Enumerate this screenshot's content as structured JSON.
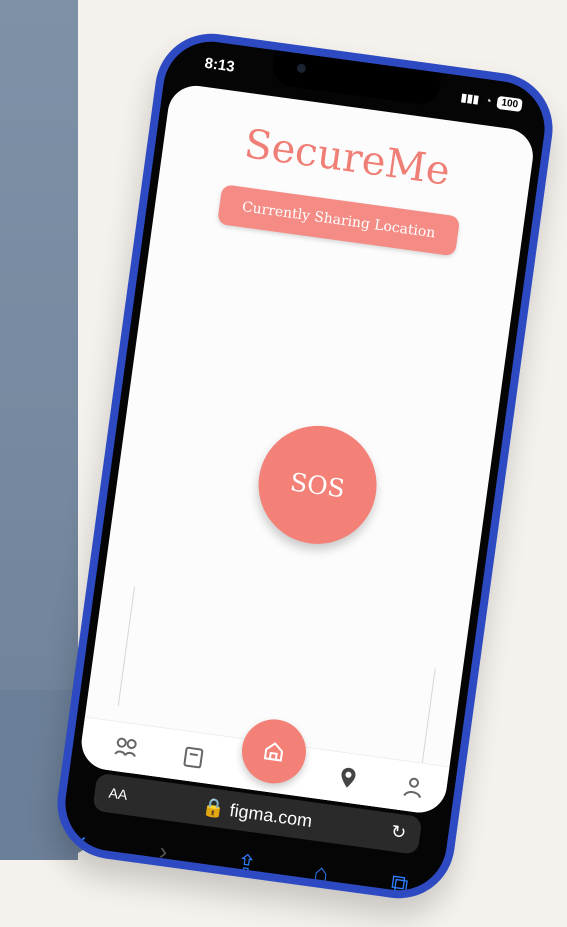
{
  "status": {
    "time": "8:13",
    "battery": "100"
  },
  "app": {
    "title": "SecureMe",
    "sharing_label": "Currently Sharing Location",
    "sos_label": "SOS"
  },
  "nav": {
    "items": [
      {
        "name": "community-icon"
      },
      {
        "name": "book-icon"
      },
      {
        "name": "home-icon"
      },
      {
        "name": "location-icon"
      },
      {
        "name": "profile-icon"
      }
    ]
  },
  "browser": {
    "text_size_label": "AA",
    "url": "figma.com",
    "reload_icon": "reload-icon"
  },
  "toolbar": {
    "icons": [
      "back-icon",
      "forward-icon",
      "share-icon",
      "bookmarks-icon",
      "tabs-icon"
    ]
  },
  "colors": {
    "accent": "#f48177",
    "phone_frame": "#2d4ac3",
    "background": "#f5f1ec"
  }
}
